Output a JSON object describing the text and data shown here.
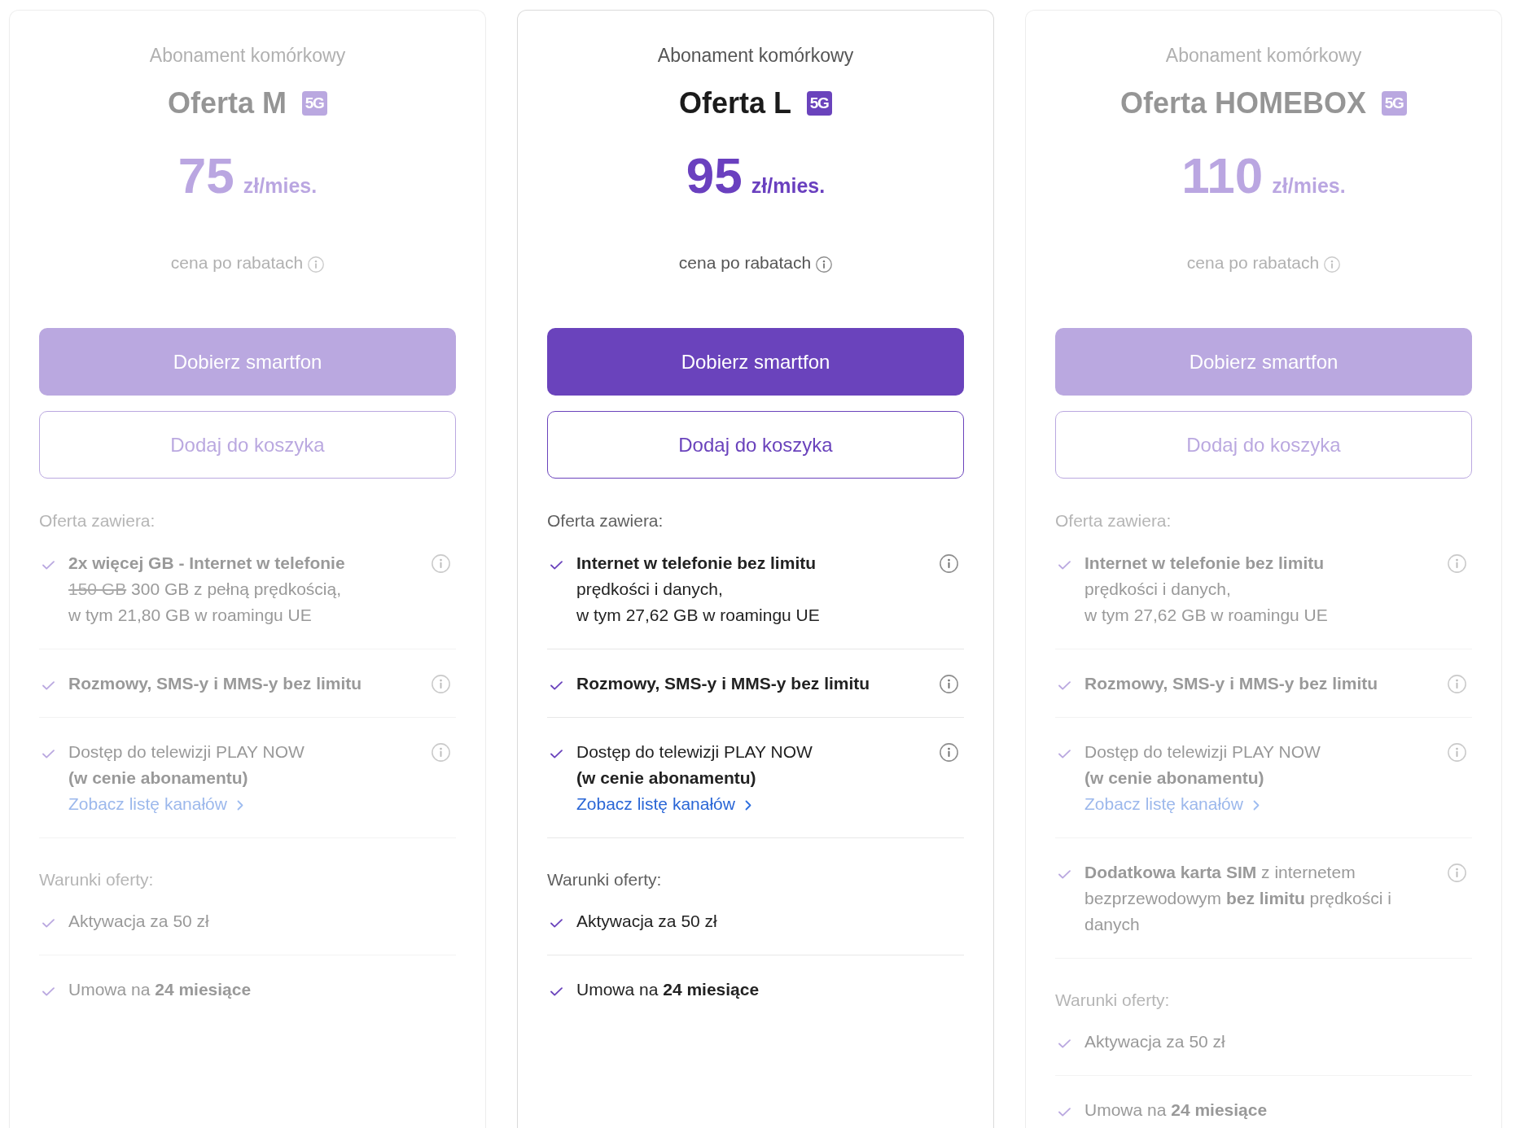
{
  "plans": [
    {
      "selected": false,
      "category": "Abonament komórkowy",
      "name": "Oferta M",
      "badge": "5G",
      "price": "75",
      "price_unit": "zł/mies.",
      "price_note": "cena po rabatach",
      "primary_button": "Dobierz smartfon",
      "secondary_button": "Dodaj do koszyka",
      "features_title": "Oferta zawiera:",
      "features": [
        {
          "title": "2x więcej GB - Internet w telefonie",
          "struck": "150 GB",
          "lines": [
            "300 GB z pełną prędkością,",
            "w tym 21,80 GB w roamingu UE"
          ]
        },
        {
          "title": "Rozmowy, SMS-y i MMS-y bez limitu"
        },
        {
          "lines": [
            "Dostęp do telewizji PLAY NOW",
            "**(w cenie abonamentu)**"
          ],
          "link": "Zobacz listę kanałów"
        }
      ],
      "terms_title": "Warunki oferty:",
      "terms": [
        "Aktywacja za 50 zł",
        "Umowa na **24 miesiące**"
      ]
    },
    {
      "selected": true,
      "category": "Abonament komórkowy",
      "name": "Oferta L",
      "badge": "5G",
      "price": "95",
      "price_unit": "zł/mies.",
      "price_note": "cena po rabatach",
      "primary_button": "Dobierz smartfon",
      "secondary_button": "Dodaj do koszyka",
      "features_title": "Oferta zawiera:",
      "features": [
        {
          "title": "Internet w telefonie bez limitu",
          "lines": [
            "prędkości i danych,",
            "w tym 27,62 GB w roamingu UE"
          ]
        },
        {
          "title": "Rozmowy, SMS-y i MMS-y bez limitu"
        },
        {
          "lines": [
            "Dostęp do telewizji PLAY NOW",
            "**(w cenie abonamentu)**"
          ],
          "link": "Zobacz listę kanałów"
        }
      ],
      "terms_title": "Warunki oferty:",
      "terms": [
        "Aktywacja za 50 zł",
        "Umowa na **24 miesiące**"
      ]
    },
    {
      "selected": false,
      "category": "Abonament komórkowy",
      "name": "Oferta HOMEBOX",
      "badge": "5G",
      "price": "110",
      "price_unit": "zł/mies.",
      "price_note": "cena po rabatach",
      "primary_button": "Dobierz smartfon",
      "secondary_button": "Dodaj do koszyka",
      "features_title": "Oferta zawiera:",
      "features": [
        {
          "title": "Internet w telefonie bez limitu",
          "lines": [
            "prędkości i danych,",
            "w tym 27,62 GB w roamingu UE"
          ]
        },
        {
          "title": "Rozmowy, SMS-y i MMS-y bez limitu"
        },
        {
          "lines": [
            "Dostęp do telewizji PLAY NOW",
            "**(w cenie abonamentu)**"
          ],
          "link": "Zobacz listę kanałów"
        },
        {
          "lines": [
            "**Dodatkowa karta SIM** z internetem",
            "bezprzewodowym **bez limitu** prędkości i",
            "danych"
          ]
        }
      ],
      "terms_title": "Warunki oferty:",
      "terms": [
        "Aktywacja za 50 zł",
        "Umowa na **24 miesiące**"
      ]
    }
  ]
}
